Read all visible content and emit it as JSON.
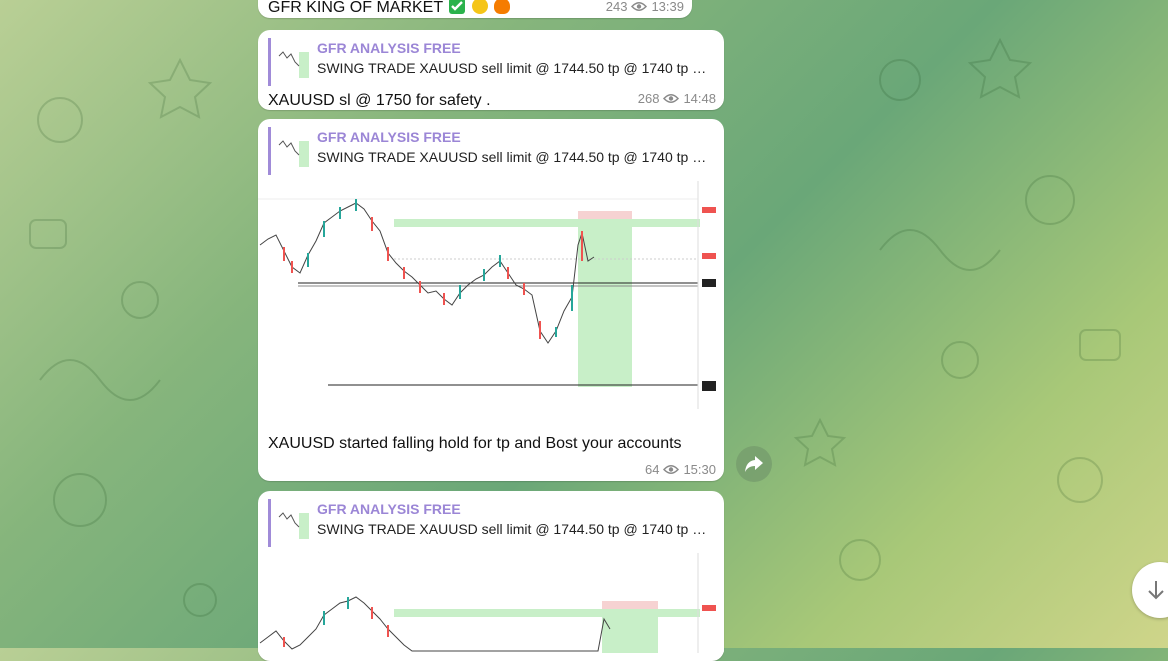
{
  "messages": [
    {
      "text": "GFR KING OF MARKET",
      "views": "243",
      "time": "13:39"
    },
    {
      "reply_name": "GFR ANALYSIS FREE",
      "reply_text": "SWING TRADE XAUUSD sell limit @ 1744.50 tp @ 1740 tp 2 @ ...",
      "text": "XAUUSD sl @ 1750 for safety .",
      "views": "268",
      "time": "14:48"
    },
    {
      "reply_name": "GFR ANALYSIS FREE",
      "reply_text": "SWING TRADE XAUUSD sell limit @ 1744.50 tp @ 1740 tp 2 @ ...",
      "text": "XAUUSD started falling hold for tp and Bost your accounts",
      "views": "64",
      "time": "15:30"
    },
    {
      "reply_name": "GFR ANALYSIS FREE",
      "reply_text": "SWING TRADE XAUUSD sell limit @ 1744.50 tp @ 1740 tp 2 @ ..."
    }
  ],
  "icons": {
    "views": "eye-icon",
    "forward": "forward-arrow-icon",
    "scroll_down": "arrow-down-icon"
  },
  "colors": {
    "reply_accent": "#9b86d6",
    "bull": "#26a69a",
    "bear": "#ef5350",
    "tp_zone": "#c8efc8",
    "sl_zone": "#f6d2d2"
  }
}
